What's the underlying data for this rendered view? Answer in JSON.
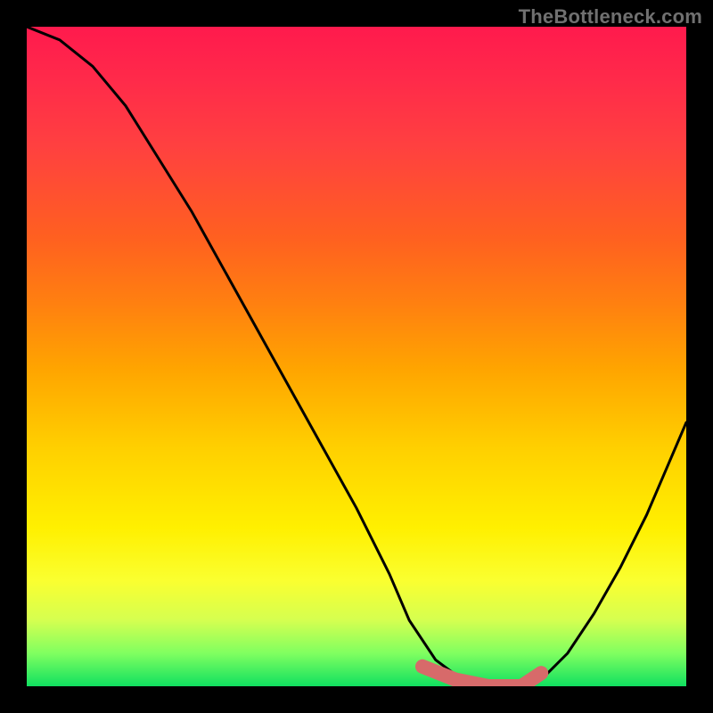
{
  "watermark": "TheBottleneck.com",
  "chart_data": {
    "type": "line",
    "title": "",
    "xlabel": "",
    "ylabel": "",
    "xlim": [
      0,
      1
    ],
    "ylim": [
      0,
      1
    ],
    "series": [
      {
        "name": "curve",
        "x": [
          0.0,
          0.05,
          0.1,
          0.15,
          0.2,
          0.25,
          0.3,
          0.35,
          0.4,
          0.45,
          0.5,
          0.55,
          0.58,
          0.62,
          0.66,
          0.7,
          0.74,
          0.78,
          0.82,
          0.86,
          0.9,
          0.94,
          0.97,
          1.0
        ],
        "values": [
          1.0,
          0.98,
          0.94,
          0.88,
          0.8,
          0.72,
          0.63,
          0.54,
          0.45,
          0.36,
          0.27,
          0.17,
          0.1,
          0.04,
          0.01,
          0.0,
          0.0,
          0.01,
          0.05,
          0.11,
          0.18,
          0.26,
          0.33,
          0.4
        ]
      },
      {
        "name": "min-highlight",
        "x": [
          0.6,
          0.65,
          0.7,
          0.75,
          0.78
        ],
        "values": [
          0.03,
          0.01,
          0.0,
          0.0,
          0.02
        ]
      }
    ],
    "colors": {
      "gradient_top": "#ff1a4d",
      "gradient_bottom": "#10e060",
      "curve": "#000000",
      "highlight": "#d76a6a",
      "frame": "#000000"
    }
  }
}
